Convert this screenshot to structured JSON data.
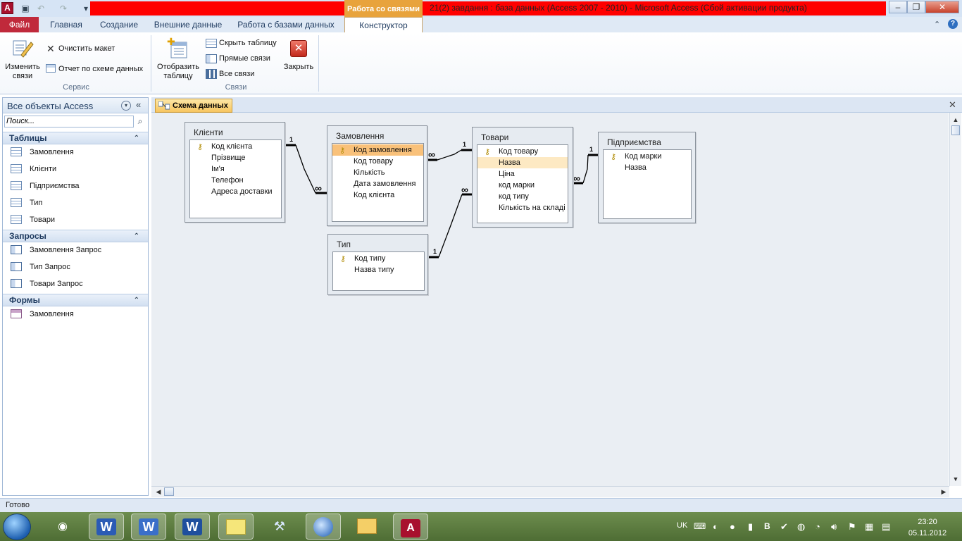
{
  "window": {
    "title": "21(2) завдання : база данных (Access 2007 - 2010)  -  Microsoft Access (Сбой активации продукта)",
    "context_tab": "Работа со связями",
    "app_icon_letter": "A"
  },
  "tabs": {
    "file": "Файл",
    "home": "Главная",
    "create": "Создание",
    "external": "Внешние данные",
    "db_tools": "Работа с базами данных",
    "design": "Конструктор"
  },
  "ribbon": {
    "edit_relationships": "Изменить связи",
    "clear_layout": "Очистить макет",
    "relationship_report": "Отчет по схеме данных",
    "group_tools": "Сервис",
    "show_table": "Отобразить таблицу",
    "hide_table": "Скрыть таблицу",
    "direct_relationships": "Прямые связи",
    "all_relationships": "Все связи",
    "close": "Закрыть",
    "group_relationships": "Связи"
  },
  "nav": {
    "title": "Все объекты Access",
    "search_placeholder": "Поиск...",
    "sections": [
      {
        "title": "Таблицы",
        "items": [
          "Замовлення",
          "Клієнти",
          "Підприємства",
          "Тип",
          "Товари"
        ]
      },
      {
        "title": "Запросы",
        "items": [
          "Замовлення Запрос",
          "Тип Запрос",
          "Товари Запрос"
        ]
      },
      {
        "title": "Формы",
        "items": [
          "Замовлення"
        ]
      }
    ]
  },
  "document": {
    "tab_label": "Схема данных"
  },
  "tables": {
    "clients": {
      "title": "Клієнти",
      "fields": [
        "Код клієнта",
        "Прізвище",
        "Ім'я",
        "Телефон",
        "Адреса доставки"
      ]
    },
    "orders": {
      "title": "Замовлення",
      "fields": [
        "Код замовлення",
        "Код товару",
        "Кількість",
        "Дата замовлення",
        "Код клієнта"
      ]
    },
    "goods": {
      "title": "Товари",
      "fields": [
        "Код товару",
        "Назва",
        "Ціна",
        "код марки",
        "код типу",
        "Кількість на складі"
      ]
    },
    "enterprises": {
      "title": "Підприємства",
      "fields": [
        "Код марки",
        "Назва"
      ]
    },
    "type": {
      "title": "Тип",
      "fields": [
        "Код типу",
        "Назва типу"
      ]
    }
  },
  "relations": {
    "one": "1",
    "many": "∞"
  },
  "status": {
    "text": "Готово"
  },
  "taskbar": {
    "lang": "UK",
    "time": "23:20",
    "date": "05.11.2012"
  }
}
